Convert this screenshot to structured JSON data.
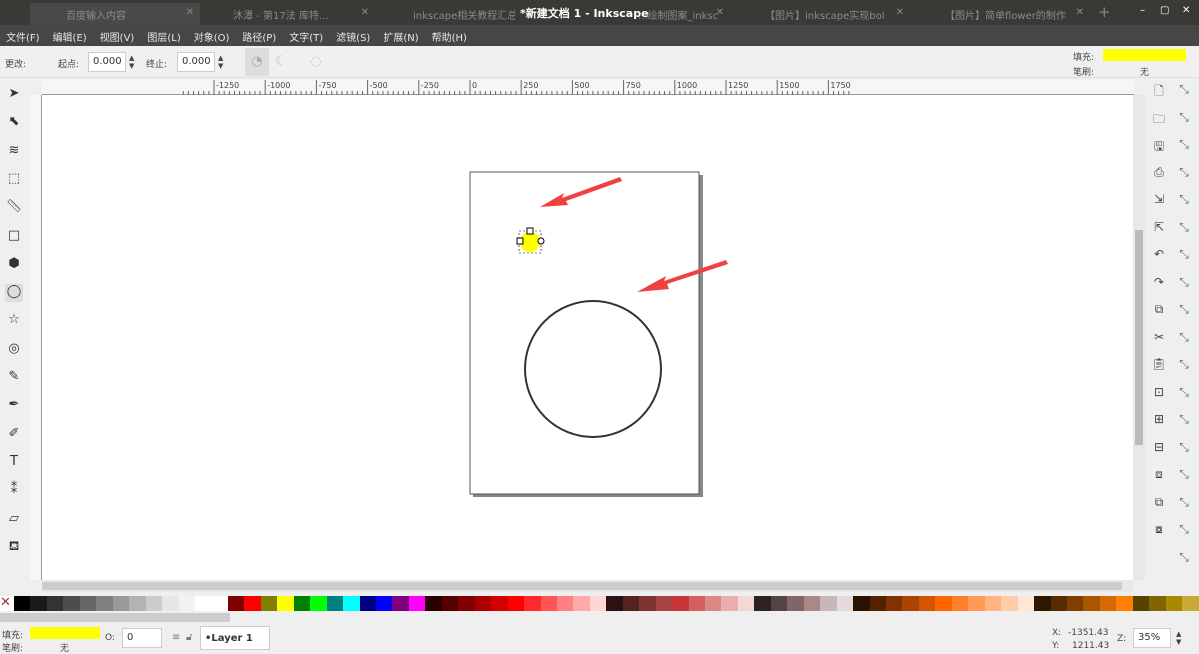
{
  "window": {
    "title": "*新建文档 1 - Inkscape",
    "tabs": [
      "百度输入内容",
      "沐潭 - 第17法 库特...",
      "inkscape相关教程汇总_",
      "...绘制图案_inksc",
      "【图片】inkscape实现bol",
      "【图片】简单flower的制作"
    ],
    "new_tab": "+",
    "controls": [
      "–",
      "▢",
      "✕"
    ]
  },
  "menu": [
    "文件(F)",
    "编辑(E)",
    "视图(V)",
    "图层(L)",
    "对象(O)",
    "路径(P)",
    "文字(T)",
    "滤镜(S)",
    "扩展(N)",
    "帮助(H)"
  ],
  "tool_controls": {
    "change_label": "更改:",
    "start_label": "起点:",
    "start_value": "0.000",
    "end_label": "终止:",
    "end_value": "0.000"
  },
  "style_indicator": {
    "fill_label": "填充:",
    "stroke_label": "笔刷:",
    "stroke_value": "无",
    "fill_color": "#ffff00"
  },
  "ruler": {
    "labels": [
      "-1250",
      "-1000",
      "-750",
      "-500",
      "-250",
      "0",
      "250",
      "500",
      "750",
      "1000",
      "1250",
      "1500",
      "1750"
    ]
  },
  "tools": [
    "selector",
    "node",
    "tweak",
    "zoom",
    "measure",
    "rect",
    "3dbox",
    "ellipse",
    "star",
    "spiral",
    "pencil",
    "pen",
    "calligraphy",
    "text",
    "spray",
    "eraser",
    "bucket"
  ],
  "palette": [
    "#000000",
    "#1a1a1a",
    "#333333",
    "#4d4d4d",
    "#666666",
    "#808080",
    "#999999",
    "#b3b3b3",
    "#cccccc",
    "#e6e6e6",
    "#f2f2f2",
    "#ffffff",
    "#ffffff",
    "#800000",
    "#ff0000",
    "#808000",
    "#ffff00",
    "#008000",
    "#00ff00",
    "#008080",
    "#00ffff",
    "#000080",
    "#0000ff",
    "#800080",
    "#ff00ff",
    "#2b0000",
    "#550000",
    "#800000",
    "#aa0000",
    "#d40000",
    "#ff0000",
    "#ff2a2a",
    "#ff5555",
    "#ff8080",
    "#ffaaaa",
    "#ffd5d5",
    "#2b1111",
    "#552222",
    "#803333",
    "#aa4444",
    "#c83737",
    "#d35f5f",
    "#de8787",
    "#e9afaf",
    "#f4d7d7",
    "#2b2222",
    "#554444",
    "#806666",
    "#aa8888",
    "#c8b7b7",
    "#e3dbdb",
    "#2b1100",
    "#552200",
    "#803300",
    "#aa4400",
    "#d45500",
    "#ff6600",
    "#ff7f2a",
    "#ff9955",
    "#ffb380",
    "#ffccaa",
    "#ffe6d5",
    "#2b1a00",
    "#552d00",
    "#803f00",
    "#aa5500",
    "#d46a00",
    "#ff7f00",
    "#554400",
    "#806600",
    "#aa8800",
    "#c8ab37"
  ],
  "status": {
    "fill_label": "填充:",
    "stroke_label": "笔刷:",
    "stroke_value": "无",
    "fill_color": "#ffff00",
    "opacity_label": "O:",
    "opacity_value": "0",
    "layer": "•Layer 1",
    "x_label": "X:",
    "x_value": "-1351.43",
    "y_label": "Y:",
    "y_value": "1211.43",
    "zoom_label": "Z:",
    "zoom_value": "35%"
  },
  "colors": {
    "arrow": "#f04040",
    "circle_stroke": "#333333"
  }
}
